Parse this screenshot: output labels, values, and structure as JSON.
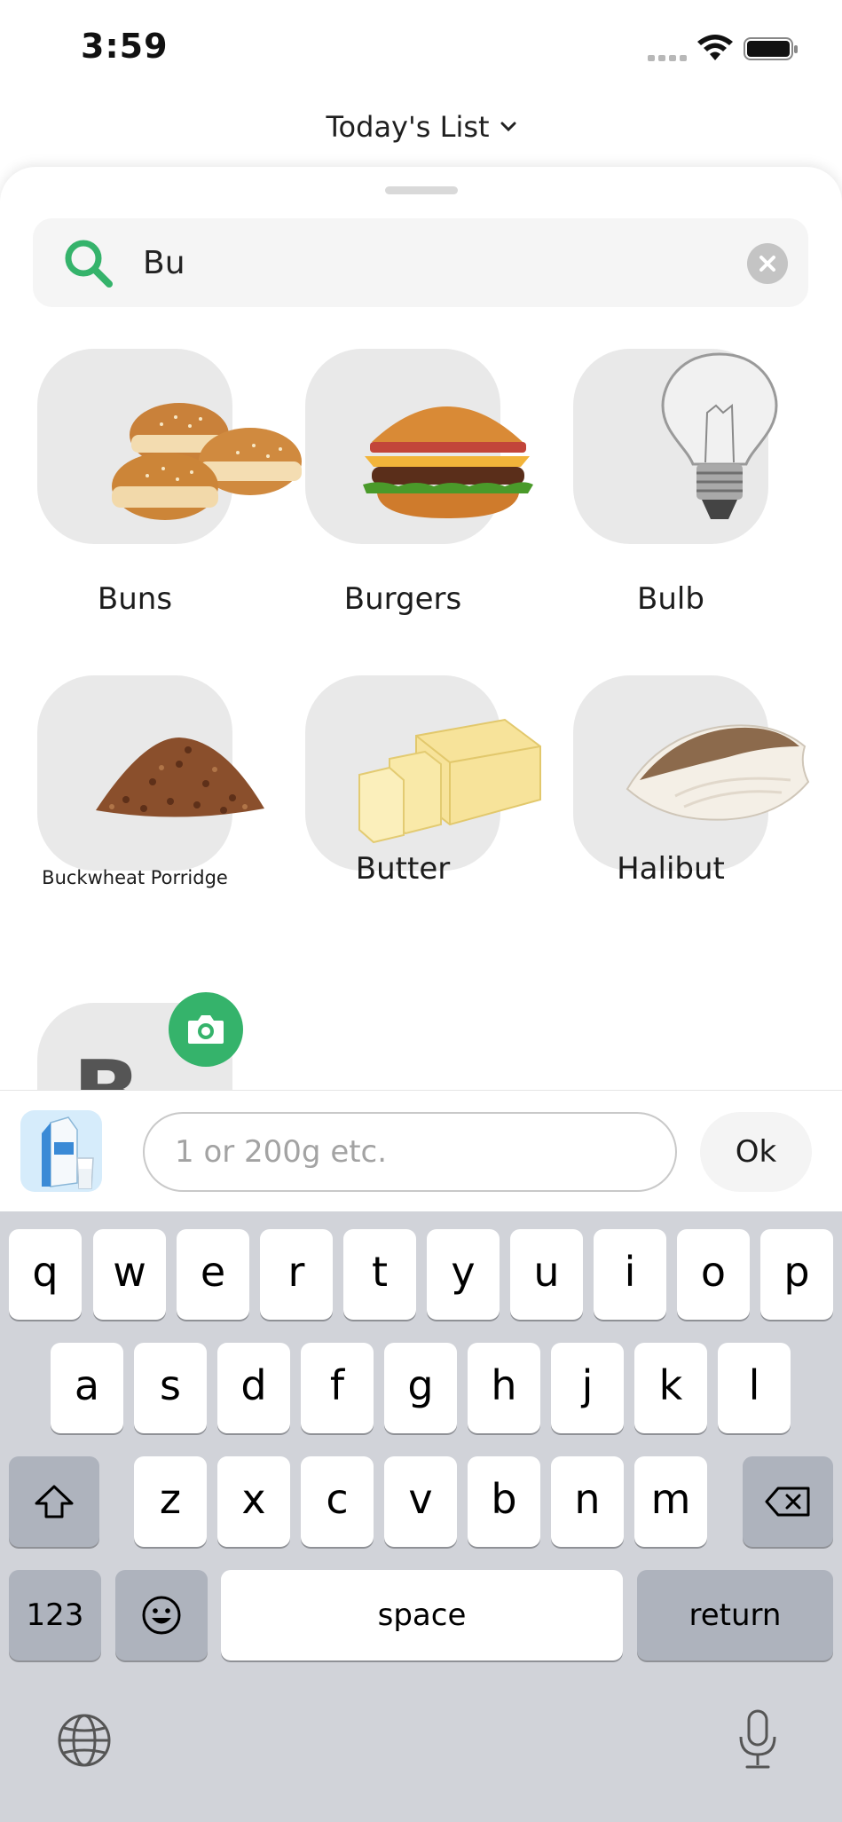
{
  "status": {
    "time": "3:59"
  },
  "header": {
    "title": "Today's List"
  },
  "search": {
    "value": "Bu",
    "placeholder": ""
  },
  "items": [
    {
      "label": "Buns"
    },
    {
      "label": "Burgers"
    },
    {
      "label": "Bulb"
    },
    {
      "label": "Buckwheat Porridge"
    },
    {
      "label": "Butter"
    },
    {
      "label": "Halibut"
    },
    {
      "label": "B"
    }
  ],
  "quantity": {
    "placeholder": "1 or 200g etc.",
    "ok_label": "Ok"
  },
  "keyboard": {
    "row1": [
      "q",
      "w",
      "e",
      "r",
      "t",
      "y",
      "u",
      "i",
      "o",
      "p"
    ],
    "row2": [
      "a",
      "s",
      "d",
      "f",
      "g",
      "h",
      "j",
      "k",
      "l"
    ],
    "row3": [
      "z",
      "x",
      "c",
      "v",
      "b",
      "n",
      "m"
    ],
    "numbers_label": "123",
    "space_label": "space",
    "return_label": "return"
  },
  "colors": {
    "accent": "#35b36b",
    "keyboard_bg": "#d1d3d9",
    "tile_bg": "#e9e9e9"
  }
}
